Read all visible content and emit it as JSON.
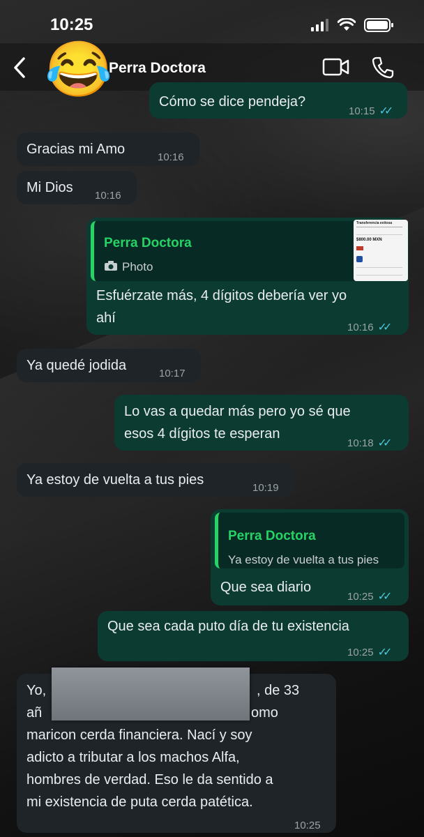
{
  "status_bar": {
    "time": "10:25"
  },
  "header": {
    "contact_name": "Perra Doctora",
    "avatar_emoji": "😂"
  },
  "colors": {
    "outgoing_bubble": "#0c3b32",
    "incoming_bubble": "#1f2428",
    "reply_accent": "#25d366",
    "read_ticks": "#4fc3d8"
  },
  "messages": [
    {
      "dir": "out",
      "text": "Cómo se dice pendeja?",
      "time": "10:15",
      "read": true
    },
    {
      "dir": "in",
      "text": "Gracias mi Amo",
      "time": "10:16"
    },
    {
      "dir": "in",
      "text": "Mi Dios",
      "time": "10:16"
    },
    {
      "dir": "out",
      "reply_to_name": "Perra Doctora",
      "reply_to_text": "Photo",
      "text_line1": "Esfuérzate más, 4 dígitos debería ver yo",
      "text_line2": "ahí",
      "time": "10:16",
      "read": true
    },
    {
      "dir": "in",
      "text": "Ya quedé jodida",
      "time": "10:17"
    },
    {
      "dir": "out",
      "text_line1": "Lo vas a quedar más pero yo sé que",
      "text_line2": "esos 4 dígitos te esperan",
      "time": "10:18",
      "read": true
    },
    {
      "dir": "in",
      "text": "Ya estoy de vuelta a tus pies",
      "time": "10:19"
    },
    {
      "dir": "out",
      "reply_to_name": "Perra Doctora",
      "reply_to_text": "Ya estoy de vuelta a tus pies",
      "text": "Que sea diario",
      "time": "10:25",
      "read": true
    },
    {
      "dir": "out",
      "text": "Que sea cada puto día de tu existencia",
      "time": "10:25",
      "read": true
    },
    {
      "dir": "in",
      "line1_start": "Yo,",
      "line1_end": ", de 33",
      "line2_start": "añ",
      "line2_end": "omo",
      "line3": "maricon cerda financiera. Nací y soy",
      "line4": "adicto a tributar a los machos Alfa,",
      "line5": "hombres de verdad. Eso le da sentido a",
      "line6": "mi existencia de puta cerda patética.",
      "time": "10:25"
    }
  ],
  "photo_thumbnail": {
    "heading": "Transferencia exitosa",
    "amount": "$800.00 MXN"
  }
}
